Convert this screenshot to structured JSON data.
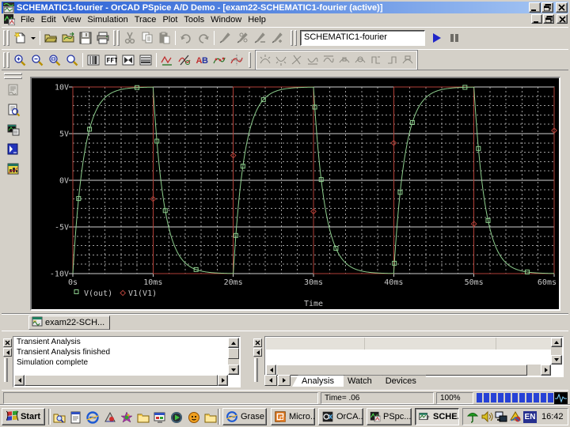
{
  "window": {
    "title": "SCHEMATIC1-fourier - OrCAD PSpice A/D Demo  - [exam22-SCHEMATIC1-fourier (active)]",
    "app_icon": "pspice-app-icon",
    "controls": [
      {
        "name": "minimize",
        "icon": "win-min-icon"
      },
      {
        "name": "restore",
        "icon": "win-restore-icon"
      },
      {
        "name": "close",
        "icon": "win-close-icon"
      }
    ]
  },
  "menu_bar": {
    "document_icon": "pspice-doc-icon",
    "items": [
      "File",
      "Edit",
      "View",
      "Simulation",
      "Trace",
      "Plot",
      "Tools",
      "Window",
      "Help"
    ],
    "controls": [
      {
        "name": "minimize",
        "icon": "win-min-icon"
      },
      {
        "name": "restore",
        "icon": "win-restore-icon"
      },
      {
        "name": "close",
        "icon": "win-close-icon"
      }
    ]
  },
  "toolbar_main": {
    "buttons": [
      {
        "name": "new",
        "icon": "new-doc-icon"
      },
      {
        "name": "new-dropdown",
        "icon": "dropdown-arrow-icon"
      },
      {
        "sep": true
      },
      {
        "name": "open",
        "icon": "open-folder-icon"
      },
      {
        "name": "append-waveform",
        "icon": "append-file-icon"
      },
      {
        "name": "save",
        "icon": "save-icon"
      },
      {
        "name": "print",
        "icon": "print-icon"
      },
      {
        "grip2": true
      },
      {
        "name": "cut",
        "icon": "cut-icon",
        "disabled": true
      },
      {
        "name": "copy",
        "icon": "copy-icon",
        "disabled": true
      },
      {
        "name": "paste",
        "icon": "paste-icon",
        "disabled": true
      },
      {
        "sep": true
      },
      {
        "name": "undo",
        "icon": "undo-icon",
        "disabled": true
      },
      {
        "name": "redo",
        "icon": "redo-icon",
        "disabled": true
      },
      {
        "sep": true
      },
      {
        "name": "voltage-marker",
        "icon": "marker-pen-icon",
        "disabled": true
      },
      {
        "name": "voltage-diff-marker",
        "icon": "marker-pen2-icon",
        "disabled": true
      },
      {
        "name": "current-marker",
        "icon": "marker-pen3-icon",
        "disabled": true
      },
      {
        "name": "power-marker",
        "icon": "marker-pen4-icon",
        "disabled": true
      }
    ],
    "profile_combo": {
      "value": "SCHEMATIC1-fourier"
    },
    "run_button": {
      "name": "run",
      "icon": "run-play-icon"
    },
    "pause_button": {
      "name": "pause",
      "icon": "pause-icon"
    }
  },
  "toolbar_view": {
    "buttons": [
      {
        "name": "zoom-in",
        "icon": "zoom-in-icon"
      },
      {
        "name": "zoom-out",
        "icon": "zoom-out-icon"
      },
      {
        "name": "zoom-area",
        "icon": "zoom-area-icon"
      },
      {
        "name": "zoom-fit",
        "icon": "zoom-fit-icon"
      },
      {
        "sep": true
      },
      {
        "name": "log-x-axis",
        "icon": "log-x-icon"
      },
      {
        "name": "fourier",
        "icon": "fft-icon"
      },
      {
        "name": "performance-analysis",
        "icon": "performance-icon"
      },
      {
        "name": "log-y-axis",
        "icon": "log-y-icon"
      },
      {
        "sep": true
      },
      {
        "name": "add-trace",
        "icon": "add-trace-icon"
      },
      {
        "name": "eval-goal-function",
        "icon": "eval-goal-icon"
      },
      {
        "name": "text-label",
        "icon": "text-label-icon"
      },
      {
        "name": "mark-data-points",
        "icon": "mark-data-icon"
      },
      {
        "name": "toggle-cursor",
        "icon": "cursor-toggle-icon"
      }
    ],
    "cursor_group_buttons": [
      {
        "name": "cursor-peak",
        "icon": "cursor-peak-icon",
        "disabled": true
      },
      {
        "name": "cursor-trough",
        "icon": "cursor-trough-icon",
        "disabled": true
      },
      {
        "name": "cursor-slope",
        "icon": "cursor-slope-icon",
        "disabled": true
      },
      {
        "name": "cursor-min",
        "icon": "cursor-min-icon",
        "disabled": true
      },
      {
        "name": "cursor-max",
        "icon": "cursor-max-icon",
        "disabled": true
      },
      {
        "name": "cursor-point",
        "icon": "cursor-point-icon",
        "disabled": true
      },
      {
        "name": "cursor-search",
        "icon": "cursor-search-icon",
        "disabled": true
      },
      {
        "name": "cursor-next-transition",
        "icon": "cursor-next-icon",
        "disabled": true
      },
      {
        "name": "cursor-prev-transition",
        "icon": "cursor-prev-icon",
        "disabled": true
      },
      {
        "name": "mark-label",
        "icon": "mark-label-icon",
        "disabled": true
      }
    ]
  },
  "left_toolbar": {
    "buttons": [
      {
        "name": "simulation-queue",
        "icon": "sim-queue-icon",
        "disabled": true
      },
      {
        "name": "view-simulation-output",
        "icon": "view-output-icon"
      },
      {
        "name": "view-simulation-results",
        "icon": "sim-results-icon"
      },
      {
        "name": "view-netlist",
        "icon": "netlist-icon"
      },
      {
        "name": "view-simulation-messages",
        "icon": "sim-messages-icon"
      }
    ]
  },
  "plot": {
    "y_axis_labels": [
      "10V",
      "5V",
      "0V",
      "-5V",
      "-10V"
    ],
    "x_axis_labels": [
      "0s",
      "10ms",
      "20ms",
      "30ms",
      "40ms",
      "50ms",
      "60ms"
    ],
    "x_axis_title": "Time",
    "legend": [
      {
        "label": "V(out)",
        "marker": "square",
        "color": "#8ecf8e"
      },
      {
        "label": "V1(V1)",
        "marker": "diamond",
        "color": "#b04038"
      }
    ],
    "text_color": "#c8c8c8",
    "grid_color": "#b9b9b9",
    "background": "#000000"
  },
  "chart_data": {
    "type": "line",
    "title": "",
    "xlabel": "Time",
    "x_unit": "ms",
    "xlim_ms": [
      0,
      60
    ],
    "ylim_v": [
      -10,
      10
    ],
    "x_major_ticks_ms": [
      0,
      10,
      20,
      30,
      40,
      50,
      60
    ],
    "y_major_ticks_v": [
      10,
      5,
      0,
      -5,
      -10
    ],
    "x_minor_step_ms": 2,
    "y_minor_step_v": 1,
    "grid": true,
    "legend_position": "bottom-left",
    "series": [
      {
        "name": "V(out)",
        "color": "#8ecf8e",
        "marker": "square",
        "shape": "exponential-rc-response",
        "period_ms": 20,
        "tau_ms": 1.4,
        "amplitude_v": 10,
        "one_cycle_points_ms_v": [
          [
            0,
            -10
          ],
          [
            0.5,
            -3.99
          ],
          [
            1,
            0.21
          ],
          [
            1.5,
            3.14
          ],
          [
            2,
            5.2
          ],
          [
            2.5,
            6.65
          ],
          [
            3,
            7.66
          ],
          [
            4,
            8.85
          ],
          [
            5,
            9.44
          ],
          [
            6,
            9.73
          ],
          [
            8,
            9.93
          ],
          [
            10,
            9.98
          ],
          [
            10.5,
            3.99
          ],
          [
            11,
            -0.21
          ],
          [
            11.5,
            -3.14
          ],
          [
            12,
            -5.2
          ],
          [
            12.5,
            -6.65
          ],
          [
            13,
            -7.66
          ],
          [
            14,
            -8.85
          ],
          [
            15,
            -9.44
          ],
          [
            16,
            -9.73
          ],
          [
            18,
            -9.93
          ],
          [
            20,
            -9.98
          ]
        ]
      },
      {
        "name": "V1(V1)",
        "color": "#b04038",
        "marker": "diamond",
        "shape": "square-wave",
        "period_ms": 20,
        "amplitude_v": 10,
        "points_ms_v": [
          [
            0,
            -10
          ],
          [
            0,
            10
          ],
          [
            10,
            10
          ],
          [
            10,
            -10
          ],
          [
            20,
            -10
          ],
          [
            20,
            10
          ],
          [
            30,
            10
          ],
          [
            30,
            -10
          ],
          [
            40,
            -10
          ],
          [
            40,
            10
          ],
          [
            50,
            10
          ],
          [
            50,
            -10
          ],
          [
            60,
            -10
          ],
          [
            60,
            10
          ]
        ]
      }
    ]
  },
  "workbook": {
    "tabs": [
      {
        "label": "exam22-SCH...",
        "icon": "waveform-doc-icon",
        "active": true
      }
    ]
  },
  "output_pane": {
    "messages": [
      "Transient Analysis",
      "Transient Analysis finished",
      "Simulation complete"
    ],
    "close_label": "x"
  },
  "watch_pane": {
    "tabs": [
      {
        "label": "Analysis",
        "active": true
      },
      {
        "label": "Watch",
        "active": false
      },
      {
        "label": "Devices",
        "active": false
      }
    ],
    "close_label": "x"
  },
  "status_bar": {
    "time_text": "Time= .06",
    "zoom_text": "100%",
    "progress_segments": 11,
    "progress_color": "#2742d6"
  },
  "taskbar": {
    "start_label": "Start",
    "start_icon": "windows-flag-icon",
    "quick_launch": [
      {
        "name": "find-folder",
        "icon": "ql-find-icon"
      },
      {
        "name": "desktop-channels",
        "icon": "ql-channels-icon"
      },
      {
        "name": "internet-explorer",
        "icon": "ie-icon"
      },
      {
        "name": "image-viewer",
        "icon": "ql-acdsee-icon"
      },
      {
        "name": "graphics-app",
        "icon": "ql-graphics-icon"
      },
      {
        "name": "folder-a",
        "icon": "folder-icon"
      },
      {
        "name": "app-window",
        "icon": "ql-appwin-icon"
      },
      {
        "name": "media-player",
        "icon": "ql-media-icon"
      },
      {
        "name": "quicktime",
        "icon": "ql-orange-icon"
      },
      {
        "name": "folder-b",
        "icon": "folder-icon"
      }
    ],
    "tasks": [
      {
        "label": "Grase ..",
        "icon": "ie-icon",
        "active": false
      },
      {
        "label": "Micro...",
        "icon": "ms-orange-icon",
        "active": false
      },
      {
        "label": "OrCA...",
        "icon": "orcad-icon",
        "active": false
      },
      {
        "label": "PSpc...",
        "icon": "pspice-doc-icon",
        "active": false
      },
      {
        "label": "SCHE...",
        "icon": "pspice-sim-icon",
        "active": true
      }
    ],
    "tray": {
      "icons": [
        {
          "name": "antivirus-umbrella",
          "icon": "umbrella-icon"
        },
        {
          "name": "volume",
          "icon": "speaker-icon"
        },
        {
          "name": "network",
          "icon": "network-icon"
        },
        {
          "name": "display-settings",
          "icon": "display-icon"
        }
      ],
      "language": "EN",
      "clock": "16:42"
    }
  }
}
